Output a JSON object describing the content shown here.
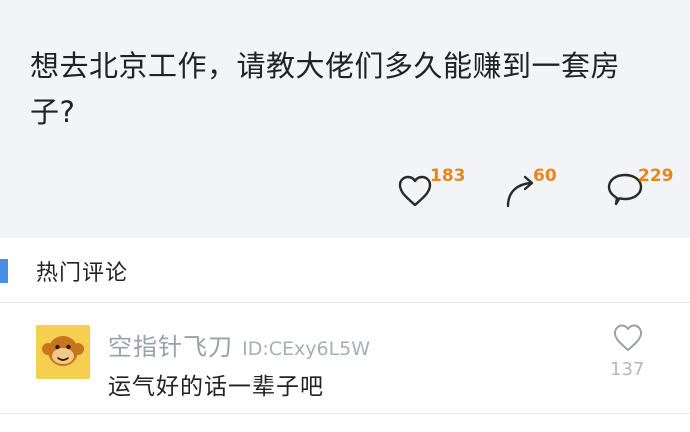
{
  "post": {
    "text": "想去北京工作，请教大佬们多久能赚到一套房子?",
    "stats": {
      "likes": "183",
      "reposts": "60",
      "comments": "229"
    }
  },
  "section": {
    "title": "热门评论"
  },
  "comment": {
    "author": "空指针飞刀",
    "user_id": "ID:CExy6L5W",
    "text": "运气好的话一辈子吧",
    "likes": "137"
  },
  "colors": {
    "accent": "#4a90e2",
    "count": "#e8861e",
    "avatar_bg": "#f7cf4f"
  }
}
